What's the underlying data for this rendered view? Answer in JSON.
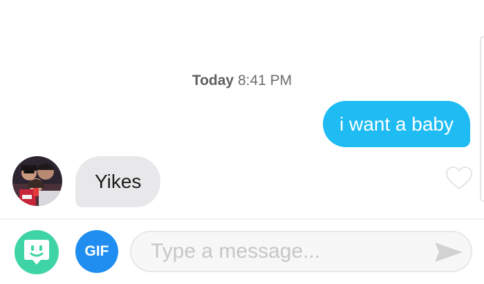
{
  "conversation": {
    "timestamp_day": "Today",
    "timestamp_time": "8:41 PM",
    "messages": [
      {
        "direction": "outgoing",
        "text": "i want a baby"
      },
      {
        "direction": "incoming",
        "text": "Yikes"
      }
    ]
  },
  "composer": {
    "gif_label": "GIF",
    "placeholder": "Type a message..."
  },
  "icons": {
    "sticker": "sticker-face-icon",
    "like": "heart-outline-icon",
    "send": "send-arrow-icon"
  },
  "colors": {
    "outgoing_bubble": "#1fbcf3",
    "incoming_bubble": "#e8e8ea",
    "sticker_button": "#3fd4a6",
    "gif_button": "#1f8ef0"
  }
}
